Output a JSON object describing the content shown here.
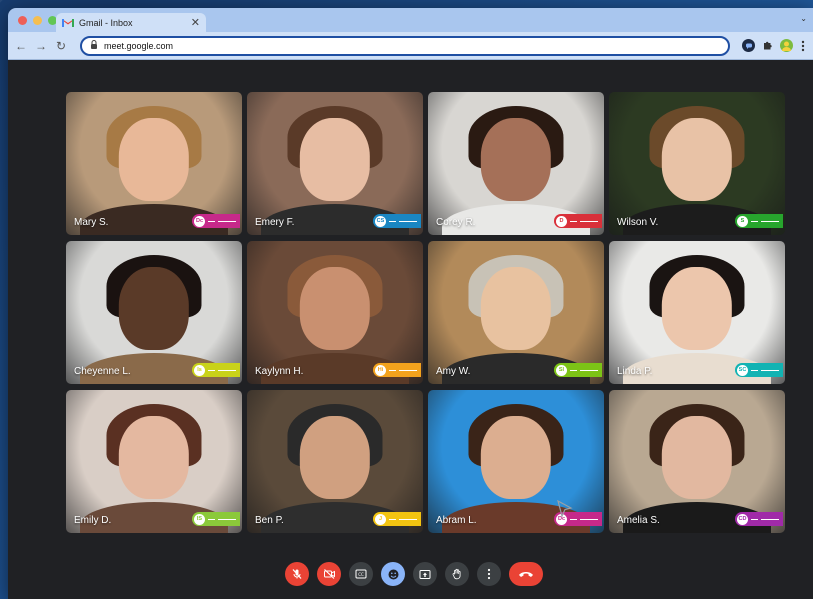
{
  "browser": {
    "tab_title": "Gmail - Inbox",
    "tab_close": "✕",
    "tab_chevron": "⌄",
    "url": "meet.google.com",
    "nav": {
      "back": "←",
      "forward": "→",
      "reload": "↻"
    },
    "lock": "🔒",
    "extensions": [
      "chat-extension-icon",
      "puzzle-extension-icon",
      "avatar-extension-icon",
      "more-menu-icon"
    ]
  },
  "participants": [
    {
      "name": "Mary S.",
      "initials": "Dc",
      "badge_color": "#c6298a",
      "bg": "#b89a7a",
      "skin": "#e8b898",
      "hair": "#a77a45",
      "shirt": "#3a2a22"
    },
    {
      "name": "Emery F.",
      "initials": "CS",
      "badge_color": "#1a86c2",
      "bg": "#8a6a58",
      "skin": "#e7bda3",
      "hair": "#5a3a28",
      "shirt": "#2c2c2c"
    },
    {
      "name": "Corey R.",
      "initials": "D",
      "badge_color": "#d9303a",
      "bg": "#d8d6d2",
      "skin": "#a57058",
      "hair": "#2a1a12",
      "shirt": "#e8e8e6"
    },
    {
      "name": "Wilson V.",
      "initials": "S",
      "badge_color": "#27a52d",
      "bg": "#2c3a22",
      "skin": "#e8c2a6",
      "hair": "#6b4a2a",
      "shirt": "#1c1c1c"
    },
    {
      "name": "Cheyenne L.",
      "initials": "Is",
      "badge_color": "#c9d21a",
      "bg": "#d9d9d7",
      "skin": "#5a3a28",
      "hair": "#1a1210",
      "shirt": "#8a6a4a"
    },
    {
      "name": "Kaylynn H.",
      "initials": "Hi",
      "badge_color": "#f3a21d",
      "bg": "#6a4a38",
      "skin": "#c99070",
      "hair": "#8a5a3a",
      "shirt": "#5a3a28"
    },
    {
      "name": "Amy W.",
      "initials": "Sl",
      "badge_color": "#7cc316",
      "bg": "#b28a5a",
      "skin": "#e8c2a0",
      "hair": "#c8c2b6",
      "shirt": "#2a2a2a"
    },
    {
      "name": "Linda P.",
      "initials": "SC",
      "badge_color": "#12b3b3",
      "bg": "#e9e9e7",
      "skin": "#ecc6ac",
      "hair": "#1a1412",
      "shirt": "#e8ddd0"
    },
    {
      "name": "Emily D.",
      "initials": "IS",
      "badge_color": "#8bc93a",
      "bg": "#d9cec6",
      "skin": "#e4b8a0",
      "hair": "#5a3022",
      "shirt": "#6a4a3a"
    },
    {
      "name": "Ben P.",
      "initials": "J",
      "badge_color": "#f2c411",
      "bg": "#5a4a3a",
      "skin": "#d0a080",
      "hair": "#2a2a2a",
      "shirt": "#2e2e2e"
    },
    {
      "name": "Abram L.",
      "initials": "Dc",
      "badge_color": "#c6298a",
      "bg": "#2d8fd8",
      "skin": "#dcae90",
      "hair": "#3a2418",
      "shirt": "#6a3a2a"
    },
    {
      "name": "Amelia S.",
      "initials": "CD",
      "badge_color": "#a02aa8",
      "bg": "#b9a892",
      "skin": "#e2b8a0",
      "hair": "#3a2418",
      "shirt": "#1a1a1a"
    }
  ],
  "controls": [
    {
      "name": "mic-off-button",
      "style": "red"
    },
    {
      "name": "camera-off-button",
      "style": "red"
    },
    {
      "name": "captions-button",
      "style": "dark"
    },
    {
      "name": "emoji-button",
      "style": "blue"
    },
    {
      "name": "present-button",
      "style": "dark"
    },
    {
      "name": "raise-hand-button",
      "style": "dark"
    },
    {
      "name": "more-options-button",
      "style": "dark"
    },
    {
      "name": "leave-call-button",
      "style": "hangup"
    }
  ]
}
